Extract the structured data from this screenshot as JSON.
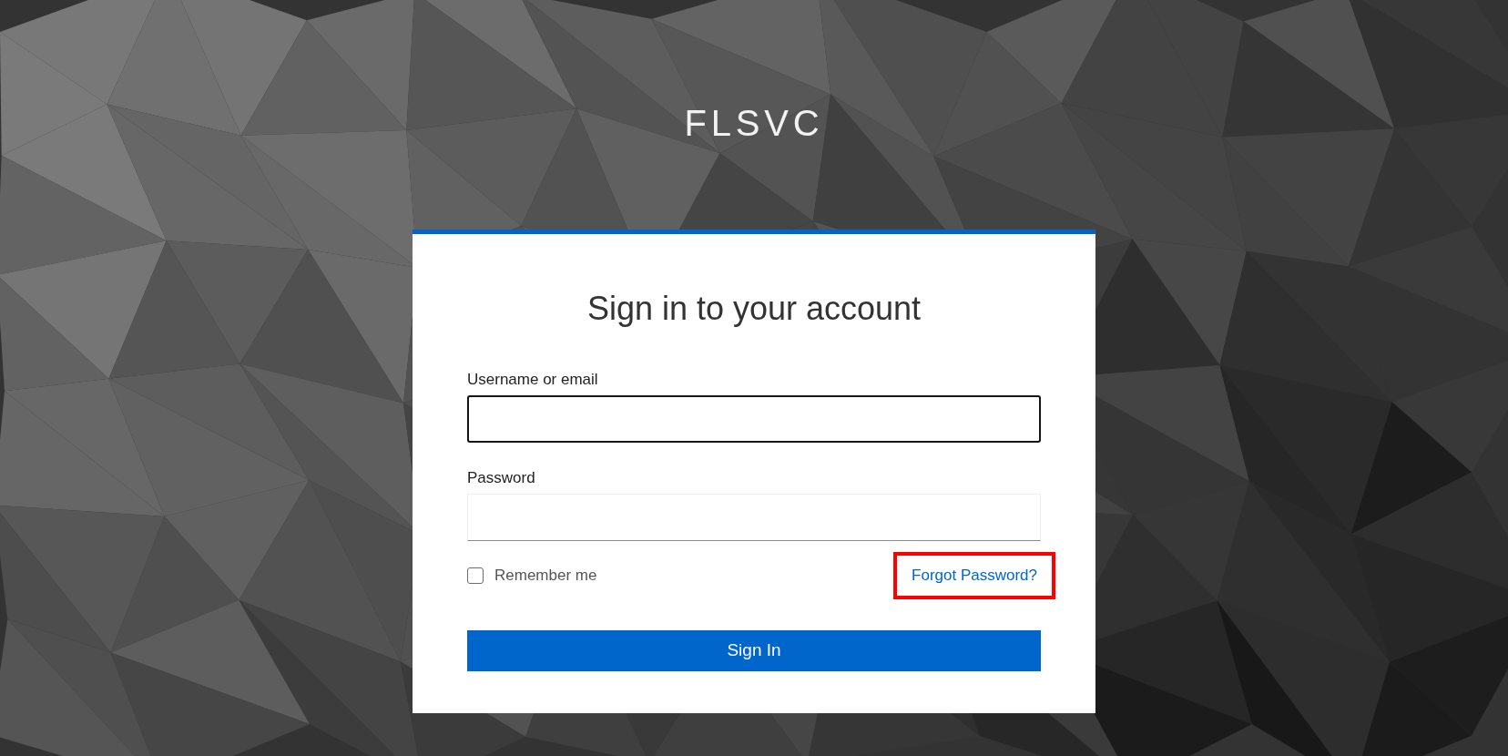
{
  "brand": {
    "title": "FLSVC"
  },
  "card": {
    "heading": "Sign in to your account"
  },
  "fields": [
    {
      "label": "Username or email",
      "focused": true
    },
    {
      "label": "Password",
      "focused": false
    }
  ],
  "remember": {
    "label": "Remember me",
    "checked": false
  },
  "forgot_link": {
    "label": "Forgot Password?",
    "highlighted": true
  },
  "submit": {
    "label": "Sign In"
  }
}
